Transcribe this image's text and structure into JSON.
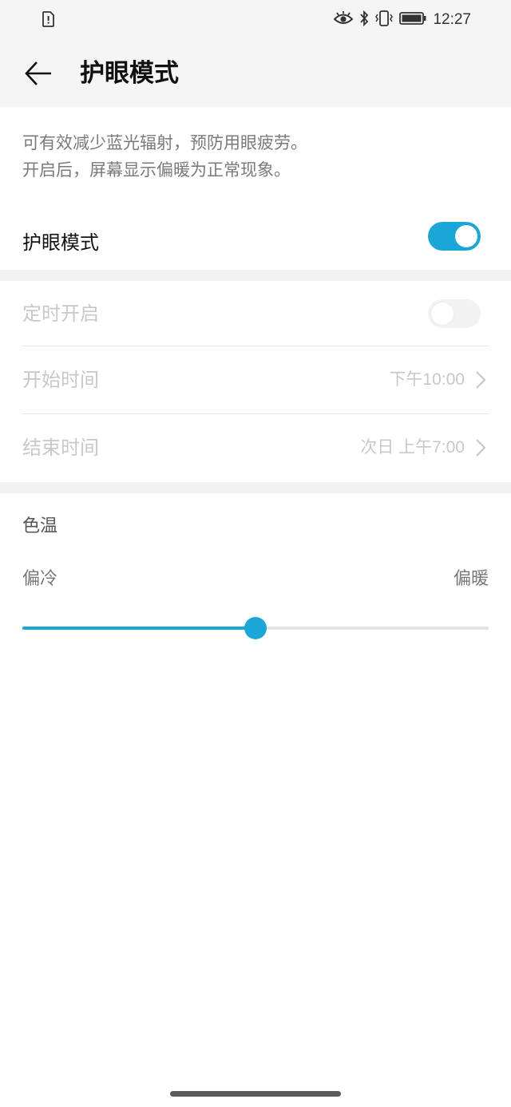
{
  "status_bar": {
    "time": "12:27",
    "icons": [
      "sim-alert-icon",
      "eye-icon",
      "bluetooth-icon",
      "vibrate-icon",
      "battery-icon"
    ]
  },
  "header": {
    "title": "护眼模式",
    "back_icon": "arrow-left-icon"
  },
  "description": {
    "line1": "可有效减少蓝光辐射，预防用眼疲劳。",
    "line2": "开启后，屏幕显示偏暖为正常现象。"
  },
  "eye_mode": {
    "label": "护眼模式",
    "enabled": true
  },
  "schedule": {
    "timer_label": "定时开启",
    "timer_enabled": false,
    "start_label": "开始时间",
    "start_value": "下午10:00",
    "end_label": "结束时间",
    "end_value": "次日 上午7:00"
  },
  "color_temperature": {
    "title": "色温",
    "cold_label": "偏冷",
    "warm_label": "偏暖",
    "value": 0.5
  },
  "colors": {
    "accent": "#1aa7d6",
    "background": "#ffffff",
    "header_bg": "#f5f5f5",
    "disabled_text": "#c8c8c8"
  }
}
